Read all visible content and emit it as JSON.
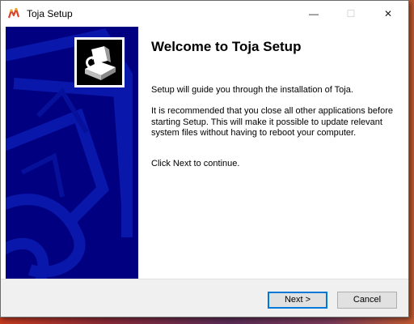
{
  "window": {
    "title": "Toja Setup",
    "minimize_glyph": "—",
    "maximize_glyph": "☐",
    "close_glyph": "✕"
  },
  "welcome": {
    "heading": "Welcome to Toja Setup",
    "paragraphs": [
      "Setup will guide you through the installation of Toja.",
      "It is recommended that you close all other applications before starting Setup. This will make it possible to update relevant system files without having to reboot your computer.",
      "Click Next to continue."
    ]
  },
  "buttons": {
    "next": "Next >",
    "cancel": "Cancel"
  },
  "icons": {
    "app": "setup-app-icon",
    "installer": "installer-box-icon"
  },
  "colors": {
    "side_panel": "#000080",
    "accent": "#0078d7"
  }
}
